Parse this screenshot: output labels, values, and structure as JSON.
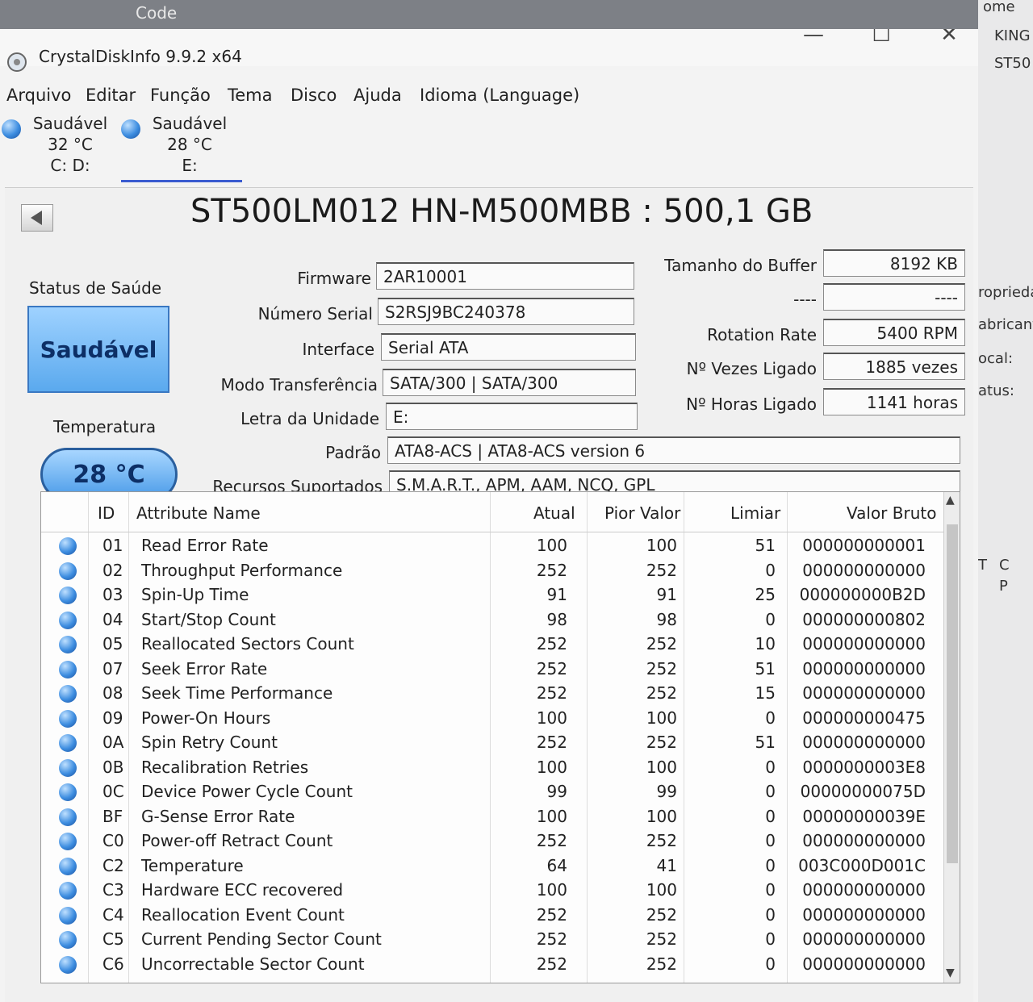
{
  "background": {
    "taskbar_label": "Code",
    "side_items": [
      "ome",
      "KING",
      "ST50",
      "roprieda",
      "abricante",
      "ocal:",
      "atus:",
      "T",
      "C",
      "P"
    ]
  },
  "window": {
    "title": "CrystalDiskInfo 9.9.2 x64",
    "controls": {
      "minimize": "—",
      "maximize": "☐",
      "close": "✕"
    }
  },
  "menu": [
    "Arquivo",
    "Editar",
    "Função",
    "Tema",
    "Disco",
    "Ajuda",
    "Idioma (Language)"
  ],
  "drives": [
    {
      "status": "Saudável",
      "temp": "32 °C",
      "letter": "C: D:"
    },
    {
      "status": "Saudável",
      "temp": "28 °C",
      "letter": "E:"
    }
  ],
  "disk": {
    "model": "ST500LM012 HN-M500MBB : 500,1 GB",
    "health_label": "Status de Saúde",
    "health_value": "Saudável",
    "temp_label": "Temperatura",
    "temp_value": "28 °C",
    "fields": {
      "firmware": {
        "label": "Firmware",
        "value": "2AR10001"
      },
      "serial": {
        "label": "Número Serial",
        "value": "S2RSJ9BC240378"
      },
      "interface": {
        "label": "Interface",
        "value": "Serial ATA"
      },
      "transfer": {
        "label": "Modo Transferência",
        "value": "SATA/300 | SATA/300"
      },
      "drive_letter": {
        "label": "Letra da Unidade",
        "value": "E:"
      },
      "standard": {
        "label": "Padrão",
        "value": "ATA8-ACS | ATA8-ACS version 6"
      },
      "features": {
        "label": "Recursos Suportados",
        "value": "S.M.A.R.T., APM, AAM, NCQ, GPL"
      },
      "buffer": {
        "label": "Tamanho do Buffer",
        "value": "8192 KB"
      },
      "blank": {
        "label": "----",
        "value": "----"
      },
      "rotation": {
        "label": "Rotation Rate",
        "value": "5400 RPM"
      },
      "power_count": {
        "label": "Nº Vezes Ligado",
        "value": "1885 vezes"
      },
      "power_hours": {
        "label": "Nº Horas Ligado",
        "value": "1141 horas"
      }
    }
  },
  "smart": {
    "headers": {
      "id": "ID",
      "name": "Attribute Name",
      "current": "Atual",
      "worst": "Pior Valor",
      "threshold": "Limiar",
      "raw": "Valor Bruto"
    },
    "rows": [
      {
        "id": "01",
        "name": "Read Error Rate",
        "current": "100",
        "worst": "100",
        "threshold": "51",
        "raw": "000000000001"
      },
      {
        "id": "02",
        "name": "Throughput Performance",
        "current": "252",
        "worst": "252",
        "threshold": "0",
        "raw": "000000000000"
      },
      {
        "id": "03",
        "name": "Spin-Up Time",
        "current": "91",
        "worst": "91",
        "threshold": "25",
        "raw": "000000000B2D"
      },
      {
        "id": "04",
        "name": "Start/Stop Count",
        "current": "98",
        "worst": "98",
        "threshold": "0",
        "raw": "000000000802"
      },
      {
        "id": "05",
        "name": "Reallocated Sectors Count",
        "current": "252",
        "worst": "252",
        "threshold": "10",
        "raw": "000000000000"
      },
      {
        "id": "07",
        "name": "Seek Error Rate",
        "current": "252",
        "worst": "252",
        "threshold": "51",
        "raw": "000000000000"
      },
      {
        "id": "08",
        "name": "Seek Time Performance",
        "current": "252",
        "worst": "252",
        "threshold": "15",
        "raw": "000000000000"
      },
      {
        "id": "09",
        "name": "Power-On Hours",
        "current": "100",
        "worst": "100",
        "threshold": "0",
        "raw": "000000000475"
      },
      {
        "id": "0A",
        "name": "Spin Retry Count",
        "current": "252",
        "worst": "252",
        "threshold": "51",
        "raw": "000000000000"
      },
      {
        "id": "0B",
        "name": "Recalibration Retries",
        "current": "100",
        "worst": "100",
        "threshold": "0",
        "raw": "0000000003E8"
      },
      {
        "id": "0C",
        "name": "Device Power Cycle Count",
        "current": "99",
        "worst": "99",
        "threshold": "0",
        "raw": "00000000075D"
      },
      {
        "id": "BF",
        "name": "G-Sense Error Rate",
        "current": "100",
        "worst": "100",
        "threshold": "0",
        "raw": "00000000039E"
      },
      {
        "id": "C0",
        "name": "Power-off Retract Count",
        "current": "252",
        "worst": "252",
        "threshold": "0",
        "raw": "000000000000"
      },
      {
        "id": "C2",
        "name": "Temperature",
        "current": "64",
        "worst": "41",
        "threshold": "0",
        "raw": "003C000D001C"
      },
      {
        "id": "C3",
        "name": "Hardware ECC recovered",
        "current": "100",
        "worst": "100",
        "threshold": "0",
        "raw": "000000000000"
      },
      {
        "id": "C4",
        "name": "Reallocation Event Count",
        "current": "252",
        "worst": "252",
        "threshold": "0",
        "raw": "000000000000"
      },
      {
        "id": "C5",
        "name": "Current Pending Sector Count",
        "current": "252",
        "worst": "252",
        "threshold": "0",
        "raw": "000000000000"
      },
      {
        "id": "C6",
        "name": "Uncorrectable Sector Count",
        "current": "252",
        "worst": "252",
        "threshold": "0",
        "raw": "000000000000"
      }
    ]
  }
}
